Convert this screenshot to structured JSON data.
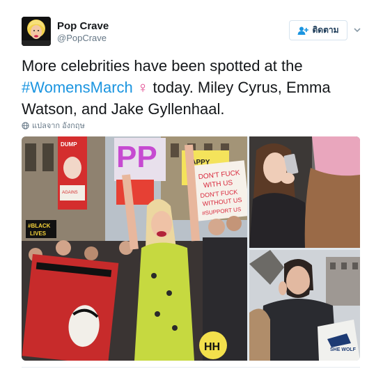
{
  "account": {
    "display_name": "Pop Crave",
    "handle": "@PopCrave",
    "follow_label": "ติดตาม"
  },
  "tweet": {
    "text_before": "More celebrities have been spotted at the ",
    "hashtag": "#WomensMarch",
    "venus_symbol": "♀",
    "text_after": " today. Miley Cyrus, Emma Watson, and Jake Gyllenhaal.",
    "translate_label": "แปลจาก อังกฤษ"
  },
  "photos": {
    "main": {
      "signs": {
        "dump": "DUMP",
        "happy": "HAPPY",
        "dont_fuck_1": "DON'T FUCK",
        "with_us": "WITH US",
        "dont_fuck_2": "DON'T FUCK",
        "without_us": "WITHOUT US",
        "support_us": "#SUPPORT US",
        "black_lives": "#BLACK",
        "lives": "LIVES",
        "agains": "AGAINS",
        "pp": "PP",
        "hh": "HH"
      }
    },
    "bottom_right": {
      "bag_text": "SHE WOLF"
    }
  },
  "colors": {
    "link": "#1b95e0",
    "venus": "#e0408a",
    "handle_gray": "#657786"
  }
}
